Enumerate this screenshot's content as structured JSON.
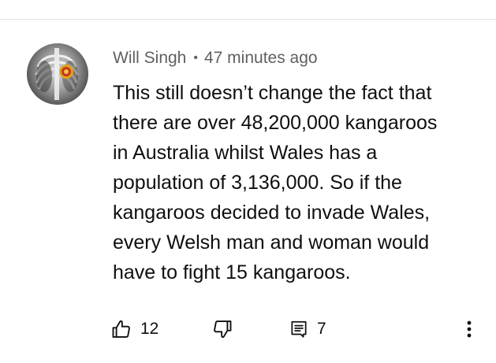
{
  "comment": {
    "author": "Will Singh",
    "separator": "•",
    "timestamp": "47 minutes ago",
    "text": "This still doesn’t change the fact that\nthere are over 48,200,000 kangaroos\nin Australia whilst Wales has a\npopulation of 3,136,000. So if the\nkangaroos decided to invade Wales,\nevery Welsh man and woman would\nhave to fight 15 kangaroos.",
    "like_count": "12",
    "reply_count": "7"
  },
  "icons": {
    "like": "thumbs-up-icon",
    "dislike": "thumbs-down-icon",
    "reply": "comment-icon",
    "more": "more-vertical-icon"
  },
  "colors": {
    "text": "#0f0f0f",
    "meta": "#606060",
    "divider": "#e3e3e3",
    "avatar_accent": "#e0a21b"
  }
}
